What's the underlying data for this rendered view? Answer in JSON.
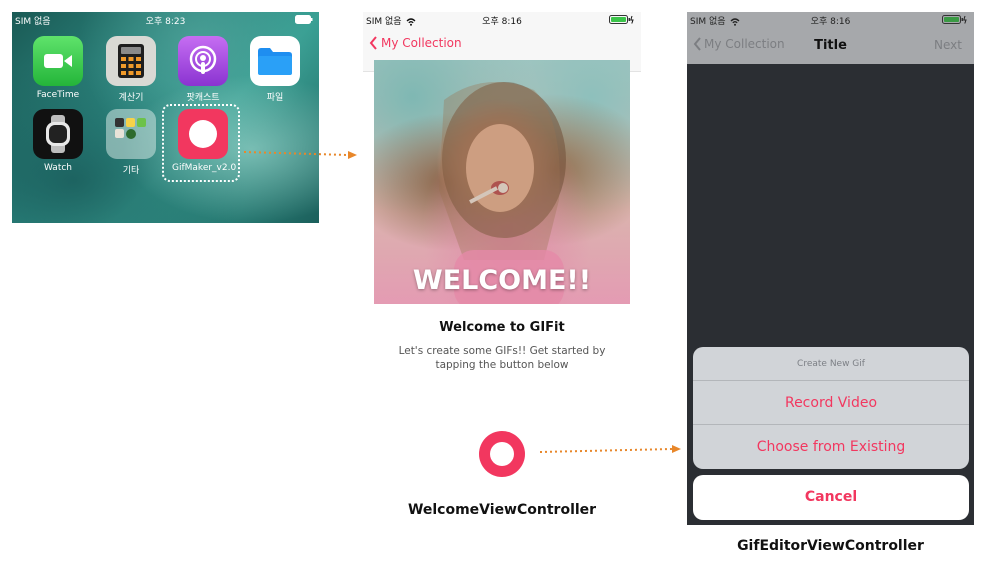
{
  "home_screen": {
    "status": {
      "carrier": "SIM 없음",
      "time": "오후 8:23"
    },
    "apps": [
      {
        "label": "FaceTime",
        "icon": "facetime-icon"
      },
      {
        "label": "계산기",
        "icon": "calculator-icon"
      },
      {
        "label": "팟캐스트",
        "icon": "podcasts-icon"
      },
      {
        "label": "파일",
        "icon": "files-icon"
      },
      {
        "label": "Watch",
        "icon": "watch-icon"
      },
      {
        "label": "기타",
        "icon": "folder-icon"
      },
      {
        "label": "GifMaker_v2.0",
        "icon": "gifmaker-icon"
      }
    ]
  },
  "welcome_screen": {
    "status": {
      "carrier": "SIM 없음",
      "time": "오후 8:16"
    },
    "nav": {
      "back_label": "My Collection"
    },
    "hero_text": "WELCOME!!",
    "title": "Welcome to GIFit",
    "subtitle": "Let's create some GIFs!! Get started by tapping the button below",
    "caption": "WelcomeViewController"
  },
  "editor_screen": {
    "status": {
      "carrier": "SIM 없음",
      "time": "오후 8:16"
    },
    "nav": {
      "back_label": "My Collection",
      "title": "Title",
      "next_label": "Next"
    },
    "action_sheet": {
      "header": "Create New Gif",
      "options": [
        "Record Video",
        "Choose from Existing"
      ],
      "cancel": "Cancel"
    },
    "caption": "GifEditorViewController"
  },
  "colors": {
    "accent": "#f2375f",
    "arrow": "#e8872a"
  }
}
